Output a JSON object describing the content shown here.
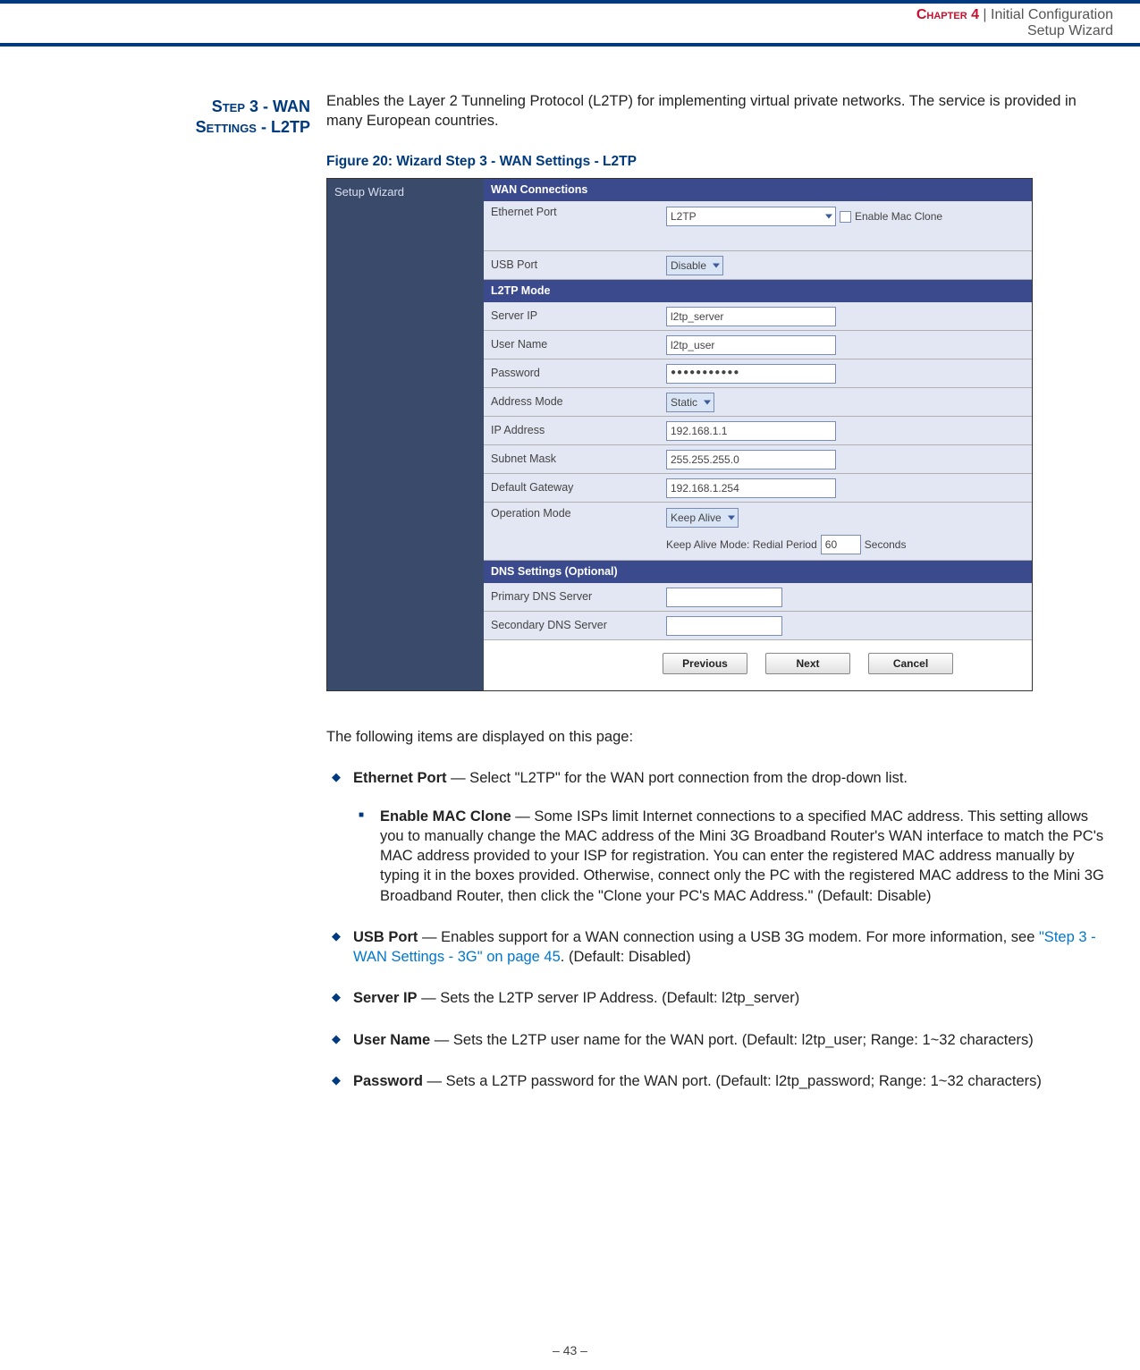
{
  "header": {
    "chapter": "Chapter 4",
    "separator": "  |  ",
    "title1": "Initial Configuration",
    "title2": "Setup Wizard"
  },
  "section_heading_l1": "Step 3 - WAN",
  "section_heading_l2": "Settings - L2TP",
  "intro": "Enables the Layer 2 Tunneling Protocol (L2TP) for implementing virtual private networks. The service is provided in many European countries.",
  "figure_caption": "Figure 20:  Wizard Step 3 - WAN Settings - L2TP",
  "screenshot": {
    "side_label": "Setup Wizard",
    "sec_wan": "WAN Connections",
    "sec_l2tp": "L2TP Mode",
    "sec_dns": "DNS Settings (Optional)",
    "rows": {
      "ethernet_port": {
        "label": "Ethernet Port",
        "value": "L2TP",
        "enable_mac": "Enable Mac Clone"
      },
      "usb_port": {
        "label": "USB Port",
        "value": "Disable"
      },
      "server_ip": {
        "label": "Server IP",
        "value": "l2tp_server"
      },
      "user_name": {
        "label": "User Name",
        "value": "l2tp_user"
      },
      "password": {
        "label": "Password",
        "value": "●●●●●●●●●●●"
      },
      "address_mode": {
        "label": "Address Mode",
        "value": "Static"
      },
      "ip_address": {
        "label": "IP Address",
        "value": "192.168.1.1"
      },
      "subnet_mask": {
        "label": "Subnet Mask",
        "value": "255.255.255.0"
      },
      "default_gw": {
        "label": "Default Gateway",
        "value": "192.168.1.254"
      },
      "op_mode": {
        "label": "Operation Mode",
        "value": "Keep Alive",
        "sub_prefix": "Keep Alive Mode: Redial Period",
        "sub_value": "60",
        "sub_suffix": "Seconds"
      },
      "pri_dns": {
        "label": "Primary DNS Server",
        "value": ""
      },
      "sec_dns": {
        "label": "Secondary DNS Server",
        "value": ""
      }
    },
    "buttons": {
      "prev": "Previous",
      "next": "Next",
      "cancel": "Cancel"
    }
  },
  "lead": "The following items are displayed on this page:",
  "items": {
    "ethernet": {
      "title": "Ethernet Port",
      "text": " — Select \"L2TP\" for the WAN port connection from the drop-down list.",
      "sub": {
        "title": "Enable MAC Clone",
        "text": " — Some ISPs limit Internet connections to a specified MAC address. This setting allows you to manually change the MAC address of the Mini 3G Broadband Router's WAN interface to match the PC's MAC address provided to your ISP for registration. You can enter the registered MAC address manually by typing it in the boxes provided. Otherwise, connect only the PC with the registered MAC address to the Mini 3G Broadband Router, then click the \"Clone your PC's MAC Address.\" (Default: Disable)"
      }
    },
    "usb": {
      "title": "USB Port",
      "text_before": " — Enables support for a WAN connection using a USB 3G modem. For more information, see ",
      "link": "\"Step 3 - WAN Settings - 3G\" on page 45",
      "text_after": ". (Default: Disabled)"
    },
    "server_ip": {
      "title": "Server IP",
      "text": " — Sets the L2TP server IP Address. (Default: l2tp_server)"
    },
    "user_name": {
      "title": "User Name",
      "text": " — Sets the L2TP user name for the WAN port. (Default: l2tp_user; Range: 1~32 characters)"
    },
    "password": {
      "title": "Password",
      "text": " — Sets a L2TP password for the WAN port. (Default: l2tp_password; Range: 1~32 characters)"
    }
  },
  "footer": "–  43  –"
}
